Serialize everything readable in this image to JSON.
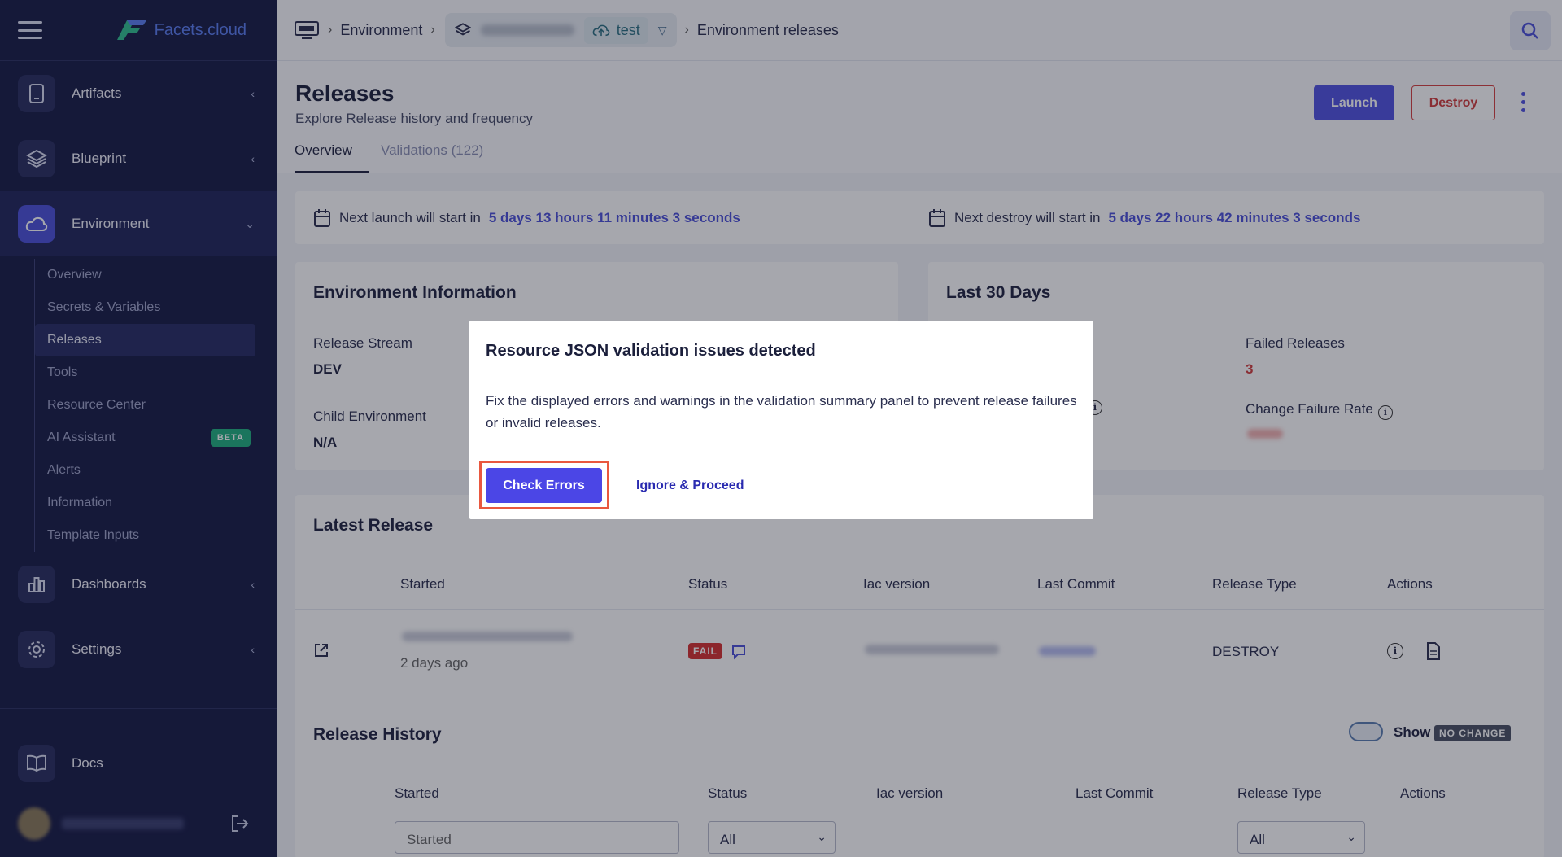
{
  "brand": {
    "name": "Facets.cloud"
  },
  "sidebar": {
    "items": [
      {
        "label": "Artifacts",
        "icon": "tablet-icon"
      },
      {
        "label": "Blueprint",
        "icon": "layers-icon"
      },
      {
        "label": "Environment",
        "icon": "cloud-icon"
      },
      {
        "label": "Dashboards",
        "icon": "bar-chart-icon"
      },
      {
        "label": "Settings",
        "icon": "gear-icon"
      },
      {
        "label": "Docs",
        "icon": "book-icon"
      }
    ],
    "sub_items": [
      {
        "label": "Overview"
      },
      {
        "label": "Secrets & Variables"
      },
      {
        "label": "Releases"
      },
      {
        "label": "Tools"
      },
      {
        "label": "Resource Center"
      },
      {
        "label": "AI Assistant",
        "badge": "BETA"
      },
      {
        "label": "Alerts"
      },
      {
        "label": "Information"
      },
      {
        "label": "Template Inputs"
      }
    ]
  },
  "topbar": {
    "crumb_env": "Environment",
    "env_name": "test",
    "crumb_page": "Environment releases"
  },
  "header": {
    "title": "Releases",
    "subtitle": "Explore Release history and frequency",
    "tabs": [
      "Overview",
      "Validations (122)"
    ],
    "launch_label": "Launch",
    "destroy_label": "Destroy"
  },
  "schedule": {
    "launch_prefix": "Next launch will start in",
    "launch_time": "5 days 13 hours 11 minutes 3 seconds",
    "destroy_prefix": "Next destroy will start in",
    "destroy_time": "5 days 22 hours 42 minutes 3 seconds"
  },
  "env_info": {
    "title": "Environment Information",
    "release_stream_label": "Release Stream",
    "release_stream_value": "DEV",
    "child_env_label": "Child Environment",
    "child_env_value": "N/A"
  },
  "last30": {
    "title": "Last 30 Days",
    "failed_label": "Failed Releases",
    "failed_value": "3",
    "cfr_label": "Change Failure Rate"
  },
  "latest_release": {
    "title": "Latest Release",
    "columns": [
      "Started",
      "Status",
      "Iac version",
      "Last Commit",
      "Release Type",
      "Actions"
    ],
    "row": {
      "started_ago": "2 days ago",
      "status": "FAIL",
      "release_type": "DESTROY"
    }
  },
  "release_history": {
    "title": "Release History",
    "show_label": "Show",
    "no_change_badge": "NO CHANGE",
    "columns": [
      "Started",
      "Status",
      "Iac version",
      "Last Commit",
      "Release Type",
      "Actions"
    ],
    "filters": {
      "started_placeholder": "Started",
      "status_value": "All",
      "type_value": "All"
    }
  },
  "modal": {
    "title": "Resource JSON validation issues detected",
    "body": "Fix the displayed errors and warnings in the validation summary panel to prevent release failures or invalid releases.",
    "primary_label": "Check Errors",
    "secondary_label": "Ignore & Proceed"
  },
  "colors": {
    "accent": "#4f52e0",
    "sidebar_bg": "#161a45",
    "danger": "#d52f2f",
    "highlight": "#e9583f"
  }
}
